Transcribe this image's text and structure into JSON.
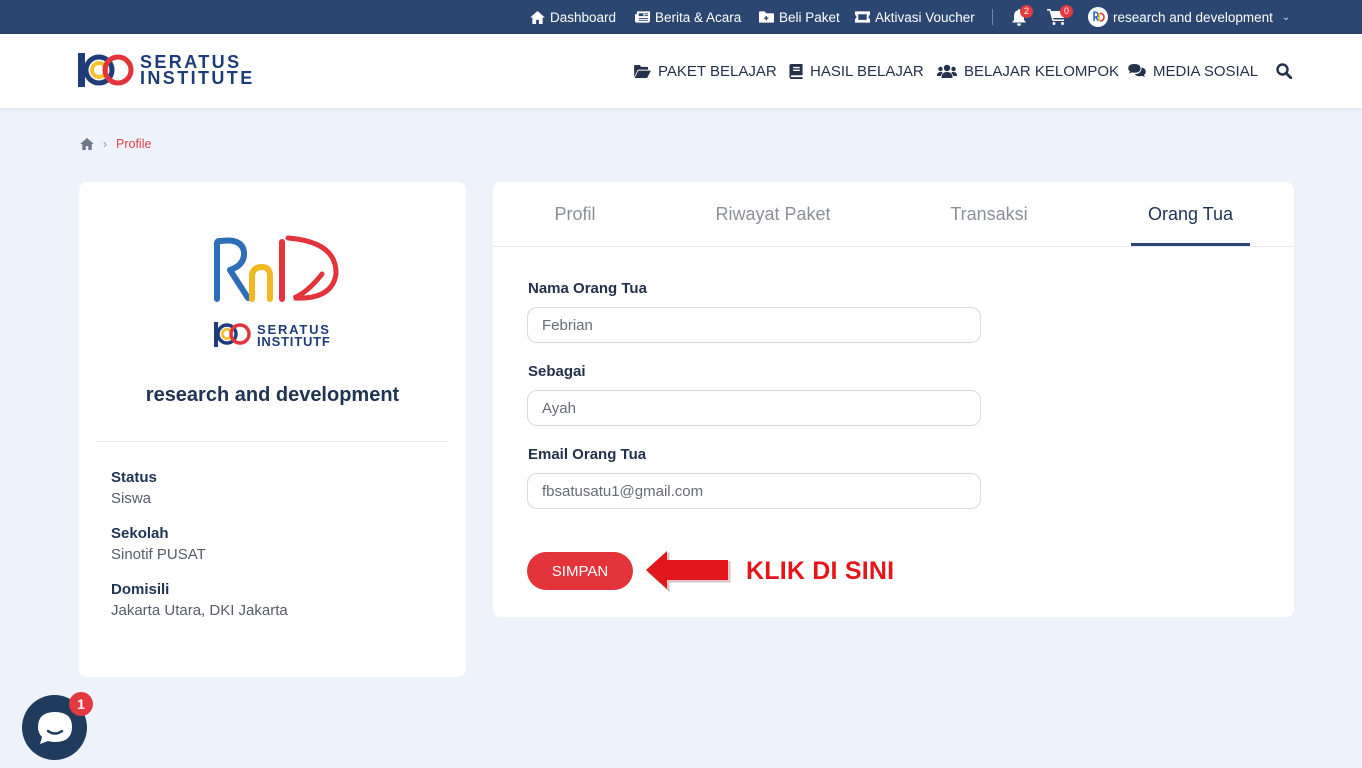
{
  "topbar": {
    "dashboard": "Dashboard",
    "news": "Berita & Acara",
    "buy": "Beli Paket",
    "voucher": "Aktivasi Voucher",
    "notif_count": "2",
    "cart_count": "0",
    "user_name": "research and development"
  },
  "header": {
    "brand_line1": "SERATUS",
    "brand_line2": "INSTITUTE",
    "nav": {
      "paket": "PAKET BELAJAR",
      "hasil": "HASIL BELAJAR",
      "kelompok": "BELAJAR KELOMPOK",
      "sosial": "MEDIA SOSIAL"
    }
  },
  "breadcrumb": {
    "sep": "›",
    "current": "Profile"
  },
  "profile": {
    "name": "research and development",
    "status_label": "Status",
    "status_value": "Siswa",
    "school_label": "Sekolah",
    "school_value": "Sinotif PUSAT",
    "domicile_label": "Domisili",
    "domicile_value": "Jakarta Utara, DKI Jakarta"
  },
  "tabs": [
    "Profil",
    "Riwayat Paket",
    "Transaksi",
    "Orang Tua"
  ],
  "active_tab": "Orang Tua",
  "form": {
    "parent_name_label": "Nama Orang Tua",
    "parent_name_value": "Febrian",
    "relation_label": "Sebagai",
    "relation_value": "Ayah",
    "email_label": "Email Orang Tua",
    "email_value": "fbsatusatu1@gmail.com",
    "submit": "SIMPAN"
  },
  "annotation": "KLIK DI SINI",
  "chat_badge": "1",
  "colors": {
    "topbar": "#2b4670",
    "accent_red": "#e3343b",
    "navy": "#1f3353",
    "background": "#eef2fb"
  }
}
